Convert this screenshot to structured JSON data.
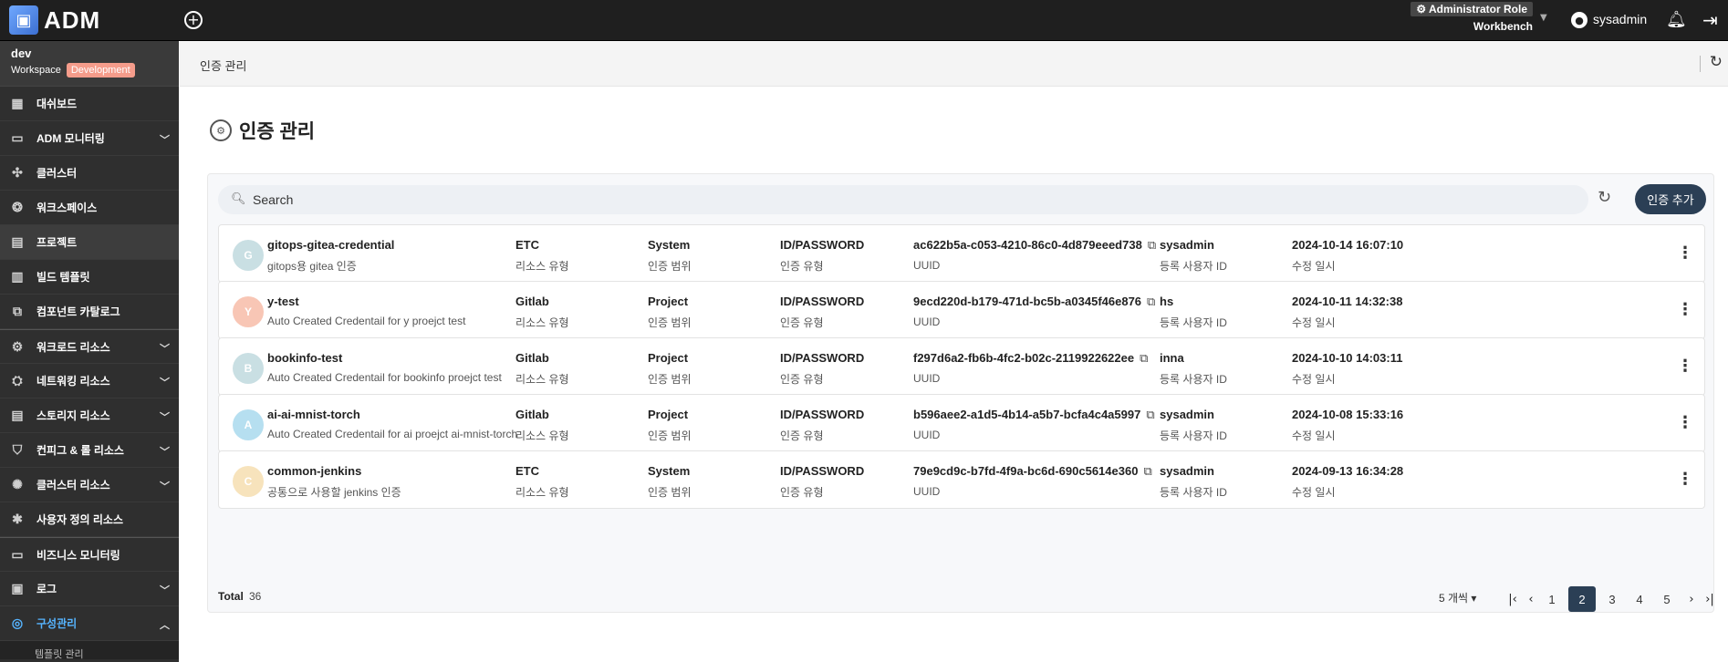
{
  "app": {
    "logo_text": "ADM",
    "role": "Administrator Role",
    "role_sub": "Workbench",
    "user": "sysadmin"
  },
  "workspace": {
    "name": "dev",
    "label": "Workspace",
    "badge": "Development"
  },
  "sidebar": {
    "items": [
      {
        "label": "대쉬보드",
        "icon": "dashboard-icon",
        "chevron": false
      },
      {
        "label": "ADM 모니터링",
        "icon": "monitor-icon",
        "chevron": true
      },
      {
        "label": "클러스터",
        "icon": "cluster-icon",
        "chevron": false
      },
      {
        "label": "워크스페이스",
        "icon": "workspace-icon",
        "chevron": false
      },
      {
        "label": "프로젝트",
        "icon": "project-icon",
        "chevron": false
      },
      {
        "label": "빌드 템플릿",
        "icon": "build-template-icon",
        "chevron": false
      },
      {
        "label": "컴포넌트 카탈로그",
        "icon": "catalog-icon",
        "chevron": false
      },
      {
        "label": "워크로드 리소스",
        "icon": "workload-icon",
        "chevron": true
      },
      {
        "label": "네트워킹 리소스",
        "icon": "network-icon",
        "chevron": true
      },
      {
        "label": "스토리지 리소스",
        "icon": "storage-icon",
        "chevron": true
      },
      {
        "label": "컨피그 & 롤 리소스",
        "icon": "config-role-icon",
        "chevron": true
      },
      {
        "label": "클러스터 리소스",
        "icon": "cluster-resource-icon",
        "chevron": true
      },
      {
        "label": "사용자 정의 리소스",
        "icon": "custom-resource-icon",
        "chevron": false
      },
      {
        "label": "비즈니스 모니터링",
        "icon": "business-monitor-icon",
        "chevron": false
      },
      {
        "label": "로그",
        "icon": "log-icon",
        "chevron": true
      },
      {
        "label": "구성관리",
        "icon": "config-manage-icon",
        "chevron": true
      }
    ],
    "sub_item": "템플릿 관리"
  },
  "breadcrumb": "인증 관리",
  "page_title": "인증 관리",
  "search": {
    "placeholder": "Search"
  },
  "add_button": "인증 추가",
  "labels": {
    "resource_type": "리소스 유형",
    "scope": "인증 범위",
    "auth_type": "인증 유형",
    "uuid": "UUID",
    "user_id": "등록 사용자 ID",
    "modified": "수정 일시"
  },
  "credentials": [
    {
      "initial": "G",
      "avatar_color": "#c9dfe3",
      "name": "gitops-gitea-credential",
      "desc": "gitops용 gitea 인증",
      "resource_type": "ETC",
      "scope": "System",
      "auth_type": "ID/PASSWORD",
      "uuid": "ac622b5a-c053-4210-86c0-4d879eeed738",
      "user": "sysadmin",
      "modified": "2024-10-14 16:07:10"
    },
    {
      "initial": "Y",
      "avatar_color": "#f8c6b5",
      "name": "y-test",
      "desc": "Auto Created Credentail for y proejct test",
      "resource_type": "Gitlab",
      "scope": "Project",
      "auth_type": "ID/PASSWORD",
      "uuid": "9ecd220d-b179-471d-bc5b-a0345f46e876",
      "user": "hs",
      "modified": "2024-10-11 14:32:38"
    },
    {
      "initial": "B",
      "avatar_color": "#c9dfe3",
      "name": "bookinfo-test",
      "desc": "Auto Created Credentail for bookinfo proejct test",
      "resource_type": "Gitlab",
      "scope": "Project",
      "auth_type": "ID/PASSWORD",
      "uuid": "f297d6a2-fb6b-4fc2-b02c-2119922622ee",
      "user": "inna",
      "modified": "2024-10-10 14:03:11"
    },
    {
      "initial": "A",
      "avatar_color": "#b6dff0",
      "name": "ai-ai-mnist-torch",
      "desc": "Auto Created Credentail for ai proejct ai-mnist-torch",
      "resource_type": "Gitlab",
      "scope": "Project",
      "auth_type": "ID/PASSWORD",
      "uuid": "b596aee2-a1d5-4b14-a5b7-bcfa4c4a5997",
      "user": "sysadmin",
      "modified": "2024-10-08 15:33:16"
    },
    {
      "initial": "C",
      "avatar_color": "#f7e3bc",
      "name": "common-jenkins",
      "desc": "공통으로 사용할 jenkins 인증",
      "resource_type": "ETC",
      "scope": "System",
      "auth_type": "ID/PASSWORD",
      "uuid": "79e9cd9c-b7fd-4f9a-bc6d-690c5614e360",
      "user": "sysadmin",
      "modified": "2024-09-13 16:34:28"
    }
  ],
  "footer": {
    "total_label": "Total",
    "total_value": "36",
    "page_size": "5 개씩",
    "pages": [
      "1",
      "2",
      "3",
      "4",
      "5"
    ],
    "current_page": "2"
  }
}
